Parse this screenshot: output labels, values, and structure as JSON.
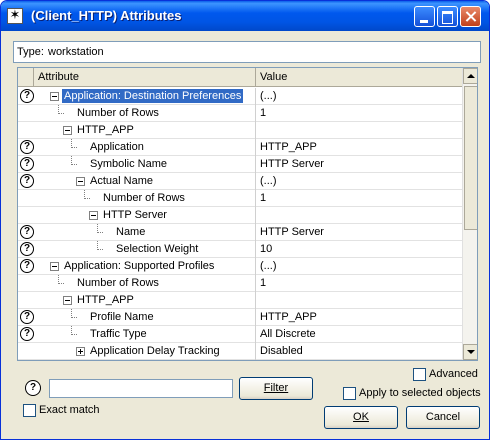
{
  "window": {
    "title": "(Client_HTTP) Attributes",
    "icon_glyph": "✶"
  },
  "type_field": {
    "label": "Type:",
    "value": "workstation"
  },
  "grid": {
    "columns": {
      "attribute": "Attribute",
      "value": "Value"
    },
    "rows": [
      {
        "help": true,
        "level": 0,
        "expander": "minus",
        "label": "Application: Destination Preferences",
        "value": "(...)",
        "selected": true
      },
      {
        "help": false,
        "level": 1,
        "expander": "none",
        "label": "Number of Rows",
        "value": "1"
      },
      {
        "help": false,
        "level": 1,
        "expander": "minus",
        "label": "HTTP_APP",
        "value": ""
      },
      {
        "help": true,
        "level": 2,
        "expander": "none",
        "label": "Application",
        "value": "HTTP_APP"
      },
      {
        "help": true,
        "level": 2,
        "expander": "none",
        "label": "Symbolic Name",
        "value": "HTTP Server"
      },
      {
        "help": true,
        "level": 2,
        "expander": "minus",
        "label": "Actual Name",
        "value": "(...)"
      },
      {
        "help": false,
        "level": 3,
        "expander": "none",
        "label": "Number of Rows",
        "value": "1"
      },
      {
        "help": false,
        "level": 3,
        "expander": "minus",
        "label": "HTTP Server",
        "value": ""
      },
      {
        "help": true,
        "level": 4,
        "expander": "none",
        "label": "Name",
        "value": "HTTP Server"
      },
      {
        "help": true,
        "level": 4,
        "expander": "none",
        "label": "Selection Weight",
        "value": "10"
      },
      {
        "help": true,
        "level": 0,
        "expander": "minus",
        "label": "Application: Supported Profiles",
        "value": "(...)"
      },
      {
        "help": false,
        "level": 1,
        "expander": "none",
        "label": "Number of Rows",
        "value": "1"
      },
      {
        "help": false,
        "level": 1,
        "expander": "minus",
        "label": "HTTP_APP",
        "value": ""
      },
      {
        "help": true,
        "level": 2,
        "expander": "none",
        "label": "Profile Name",
        "value": "HTTP_APP"
      },
      {
        "help": true,
        "level": 2,
        "expander": "none",
        "label": "Traffic Type",
        "value": "All Discrete"
      },
      {
        "help": false,
        "level": 2,
        "expander": "plus",
        "label": "Application Delay Tracking",
        "value": "Disabled"
      }
    ]
  },
  "controls": {
    "help_glyph": "?",
    "search_value": "",
    "filter_button": "Filter",
    "exact_match": {
      "label": "Exact match",
      "checked": false
    },
    "advanced": {
      "label": "Advanced",
      "checked": false
    },
    "apply_selected": {
      "label": "Apply to selected objects",
      "checked": false
    },
    "ok_button": "OK",
    "cancel_button": "Cancel"
  }
}
